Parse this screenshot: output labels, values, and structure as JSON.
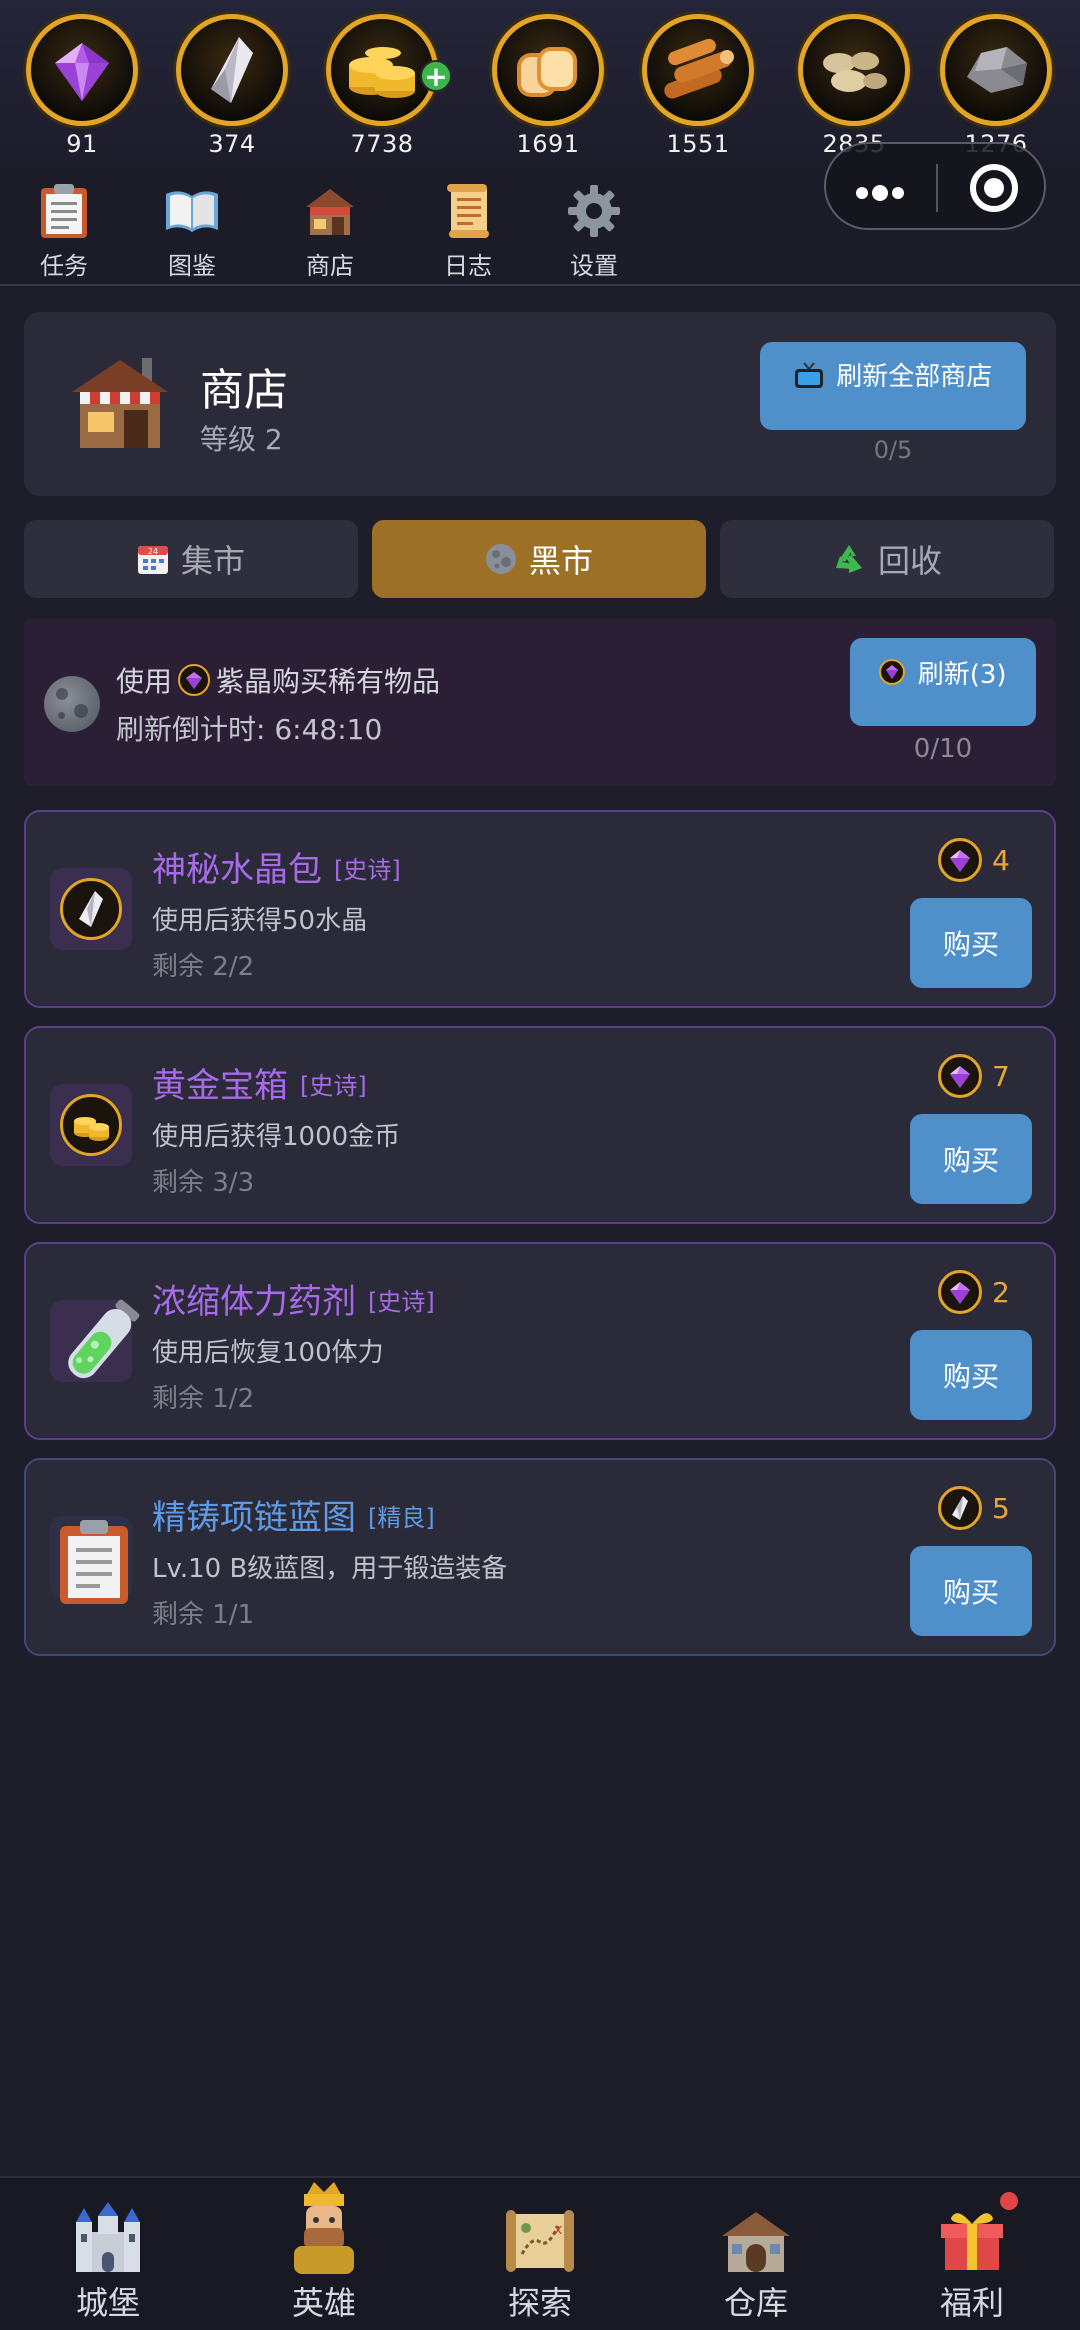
{
  "resources": [
    {
      "name": "purple-crystal",
      "value": "91"
    },
    {
      "name": "crystal",
      "value": "374"
    },
    {
      "name": "gold-coins",
      "value": "7738"
    },
    {
      "name": "bread",
      "value": "1691"
    },
    {
      "name": "wood",
      "value": "1551"
    },
    {
      "name": "stone",
      "value": "2835"
    },
    {
      "name": "iron-ore",
      "value": "1276"
    }
  ],
  "top_menu": [
    {
      "label": "任务",
      "icon": "clipboard-icon"
    },
    {
      "label": "图鉴",
      "icon": "book-icon"
    },
    {
      "label": "商店",
      "icon": "shop-icon"
    },
    {
      "label": "日志",
      "icon": "scroll-icon"
    },
    {
      "label": "设置",
      "icon": "gear-icon"
    }
  ],
  "shop": {
    "title": "商店",
    "level": "等级 2",
    "refresh_all_label": "刷新全部商店",
    "refresh_all_count": "0/5"
  },
  "tabs": [
    {
      "label": "集市",
      "icon": "calendar-icon",
      "active": false
    },
    {
      "label": "黑市",
      "icon": "moon-icon",
      "active": true
    },
    {
      "label": "回收",
      "icon": "recycle-icon",
      "active": false
    }
  ],
  "black_market": {
    "line1_prefix": "使用",
    "line1_suffix": "紫晶购买稀有物品",
    "countdown": "刷新倒计时: 6:48:10",
    "refresh_label": "刷新(3)",
    "refresh_count": "0/10"
  },
  "items": [
    {
      "name": "神秘水晶包",
      "tag": "[史诗]",
      "desc": "使用后获得50水晶",
      "remaining": "剩余 2/2",
      "price": "4",
      "price_currency": "purple-crystal",
      "icon": "crystal-icon",
      "buy_label": "购买"
    },
    {
      "name": "黄金宝箱",
      "tag": "[史诗]",
      "desc": "使用后获得1000金币",
      "remaining": "剩余 3/3",
      "price": "7",
      "price_currency": "purple-crystal",
      "icon": "gold-coins-icon",
      "buy_label": "购买"
    },
    {
      "name": "浓缩体力药剂",
      "tag": "[史诗]",
      "desc": "使用后恢复100体力",
      "remaining": "剩余 1/2",
      "price": "2",
      "price_currency": "purple-crystal",
      "icon": "potion-icon",
      "buy_label": "购买"
    },
    {
      "name": "精铸项链蓝图",
      "tag": "[精良]",
      "desc": "Lv.10 B级蓝图，用于锻造装备",
      "remaining": "剩余 1/1",
      "price": "5",
      "price_currency": "crystal",
      "icon": "blueprint-icon",
      "buy_label": "购买"
    }
  ],
  "bottom_nav": [
    {
      "label": "城堡",
      "icon": "castle-icon"
    },
    {
      "label": "英雄",
      "icon": "hero-icon"
    },
    {
      "label": "探索",
      "icon": "map-icon"
    },
    {
      "label": "仓库",
      "icon": "warehouse-icon"
    },
    {
      "label": "福利",
      "icon": "gift-icon"
    }
  ],
  "colors": {
    "background": "#1e1e2b",
    "card": "#2a2a39",
    "accent_button": "#4f8fca",
    "active_tab": "#9c7026",
    "epic": "#a86ae8",
    "rare": "#5f9ae6",
    "price": "#e8a93a"
  }
}
